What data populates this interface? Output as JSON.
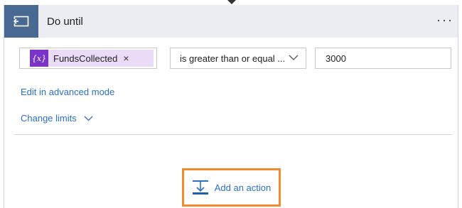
{
  "header": {
    "title": "Do until",
    "more_label": "…",
    "icon": "do-until-loop-icon"
  },
  "condition": {
    "token_icon_text": "{x}",
    "token_label": "FundsCollected",
    "token_remove": "×",
    "operator": "is greater than or equal ...",
    "value": "3000"
  },
  "links": {
    "edit_advanced": "Edit in advanced mode",
    "change_limits": "Change limits"
  },
  "add_action": {
    "label": "Add an action",
    "icon": "add-action-icon"
  },
  "colors": {
    "header_icon_bg": "#486991",
    "header_bg": "#eaedf1",
    "token_bg": "#eadcf7",
    "token_icon_bg": "#7a35c8",
    "link": "#2b6fca",
    "highlight_border": "#f28a2e"
  }
}
